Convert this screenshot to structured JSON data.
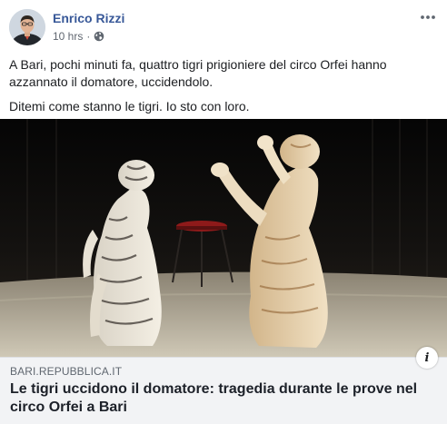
{
  "post": {
    "author": "Enrico Rizzi",
    "timestamp": "10 hrs",
    "separator": "·",
    "audience_icon": "globe-icon",
    "more_icon": "more-options-icon",
    "text_paragraphs": [
      "A Bari, pochi minuti fa, quattro tigri prigioniere del circo Orfei hanno azzannato il domatore, uccidendolo.",
      "Ditemi come stanno le tigri. Io sto con loro."
    ]
  },
  "link_preview": {
    "domain": "BARI.REPUBBLICA.IT",
    "headline": "Le tigri uccidono il domatore: tragedia durante le prove nel circo Orfei a Bari",
    "info_icon": "info-icon",
    "info_glyph": "i"
  },
  "colors": {
    "author_link": "#385898",
    "meta_text": "#606770",
    "caption_bg": "#f2f3f5"
  }
}
